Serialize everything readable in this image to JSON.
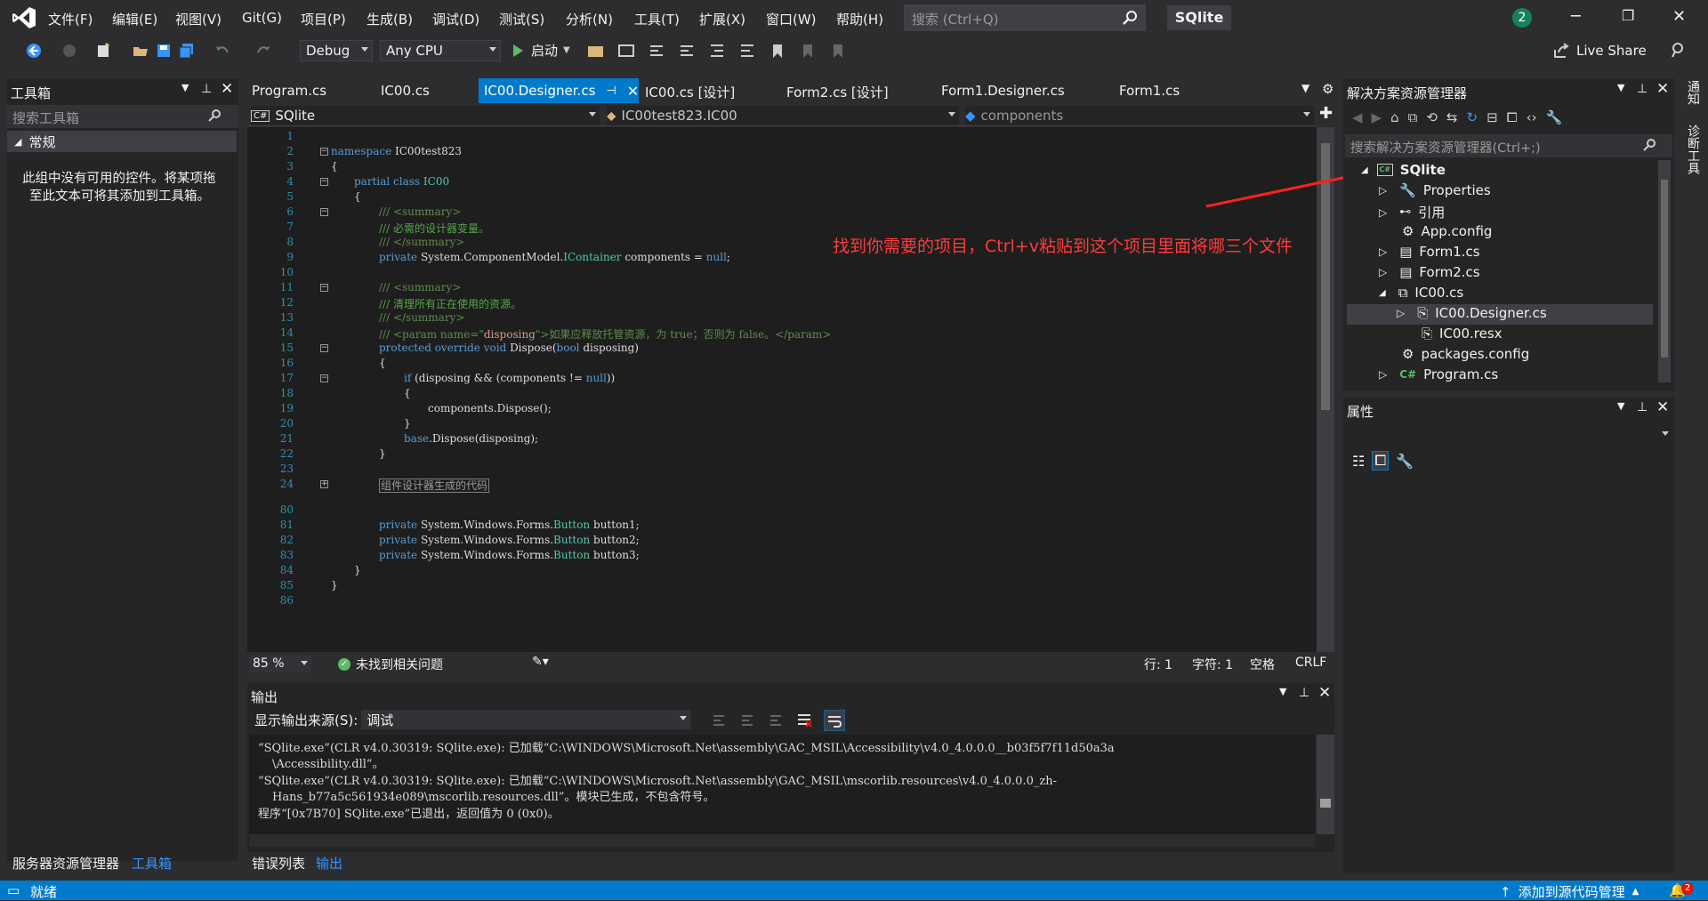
{
  "menubar": {
    "items": [
      "文件(F)",
      "编辑(E)",
      "视图(V)",
      "Git(G)",
      "项目(P)",
      "生成(B)",
      "调试(D)",
      "测试(S)",
      "分析(N)",
      "工具(T)",
      "扩展(X)",
      "窗口(W)",
      "帮助(H)"
    ],
    "search_placeholder": "搜索 (Ctrl+Q)",
    "solution_name": "SQlite",
    "notification_count": "2"
  },
  "toolbar": {
    "configuration": "Debug",
    "platform": "Any CPU",
    "start_label": "启动",
    "live_share": "Live Share"
  },
  "toolbox": {
    "title": "工具箱",
    "search_placeholder": "搜索工具箱",
    "group": "常规",
    "empty_message_line1": "此组中没有可用的控件。将某项拖",
    "empty_message_line2": "至此文本可将其添加到工具箱。",
    "bottom_tabs": [
      "服务器资源管理器",
      "工具箱"
    ]
  },
  "editor": {
    "tabs": [
      "Program.cs",
      "IC00.cs",
      "IC00.Designer.cs",
      "IC00.cs [设计]",
      "Form2.cs [设计]",
      "Form1.Designer.cs",
      "Form1.cs"
    ],
    "nav_project": "SQlite",
    "nav_class": "IC00test823.IC00",
    "nav_member": "components",
    "line_numbers": [
      "1",
      "2",
      "3",
      "4",
      "5",
      "6",
      "7",
      "8",
      "9",
      "10",
      "11",
      "12",
      "13",
      "14",
      "15",
      "16",
      "17",
      "18",
      "19",
      "20",
      "21",
      "22",
      "23",
      "24",
      "80",
      "81",
      "82",
      "83",
      "84",
      "85",
      "86"
    ],
    "zoom": "85 %",
    "issues": "未找到相关问题",
    "line": "行: 1",
    "char": "字符: 1",
    "spaces": "空格",
    "eol": "CRLF"
  },
  "code": {
    "ns_kw": "namespace",
    "ns_name": " IC00test823",
    "brace_open": "{",
    "brace_close": "}",
    "partial_kw": "partial class",
    "class_name": " IC00",
    "summary_open": "/// <summary>",
    "summary_close": "/// </summary>",
    "c1": "/// 必需的设计器变量。",
    "private_kw": "private",
    "field_type_ns": " System.ComponentModel.",
    "field_type": "IContainer",
    "field_rest": " components = ",
    "null_kw": "null",
    "semi": ";",
    "c2": "/// 清理所有正在使用的资源。",
    "param_tag_open": "/// <param name=\"",
    "param_name": "disposing",
    "param_tag_close": "\">如果应释放托管资源，为 true；否则为 false。</param>",
    "protected_kw": "protected override void",
    "dispose_sig_a": " Dispose(",
    "bool_kw": "bool",
    "dispose_sig_b": " disposing)",
    "if_kw": "if",
    "if_cond_a": " (disposing && (components != ",
    "if_cond_b": "))",
    "dispose_call": "components.Dispose();",
    "base_kw": "base",
    "base_call": ".Dispose(disposing);",
    "region_text": "组件设计器生成的代码",
    "btn_ns": " System.Windows.Forms.",
    "btn_type": "Button",
    "btn1": " button1;",
    "btn2": " button2;",
    "btn3": " button3;"
  },
  "annotation_text": "找到你需要的项目，Ctrl+v粘贴到这个项目里面将哪三个文件",
  "solution_explorer": {
    "title": "解决方案资源管理器",
    "search_placeholder": "搜索解决方案资源管理器(Ctrl+;)",
    "items": [
      "SQlite",
      "Properties",
      "引用",
      "App.config",
      "Form1.cs",
      "Form2.cs",
      "IC00.cs",
      "IC00.Designer.cs",
      "IC00.resx",
      "packages.config",
      "Program.cs"
    ]
  },
  "properties": {
    "title": "属性"
  },
  "output": {
    "title": "输出",
    "source_label": "显示输出来源(S):",
    "source_value": "调试",
    "lines": [
      "“SQlite.exe”(CLR v4.0.30319: SQlite.exe): 已加载“C:\\WINDOWS\\Microsoft.Net\\assembly\\GAC_MSIL\\Accessibility\\v4.0_4.0.0.0__b03f5f7f11d50a3a",
      "\\Accessibility.dll”。",
      "“SQlite.exe”(CLR v4.0.30319: SQlite.exe): 已加载“C:\\WINDOWS\\Microsoft.Net\\assembly\\GAC_MSIL\\mscorlib.resources\\v4.0_4.0.0.0_zh-",
      "Hans_b77a5c561934e089\\mscorlib.resources.dll”。模块已生成，不包含符号。",
      "程序“[0x7B70] SQlite.exe”已退出，返回值为 0 (0x0)。"
    ],
    "bottom_tabs": [
      "错误列表",
      "输出"
    ]
  },
  "side_tabs": [
    "通知",
    "诊断工具"
  ],
  "status": {
    "ready": "就绪",
    "source_control": "添加到源代码管理",
    "badge": "2"
  },
  "colors": {
    "accent": "#007acc",
    "background": "#2d2d30",
    "editor_bg": "#1e1e1e",
    "annotation": "#ff3b3b"
  }
}
